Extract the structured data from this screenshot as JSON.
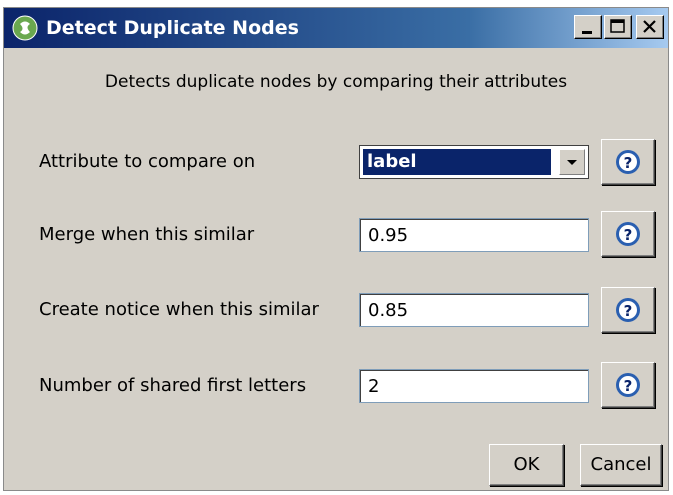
{
  "window": {
    "title": "Detect Duplicate Nodes"
  },
  "description": "Detects duplicate nodes by comparing their attributes",
  "fields": [
    {
      "label": "Attribute to compare on",
      "type": "select",
      "value": "label"
    },
    {
      "label": "Merge when this similar",
      "type": "text",
      "value": "0.95"
    },
    {
      "label": "Create notice when this similar",
      "type": "text",
      "value": "0.85"
    },
    {
      "label": "Number of shared first letters",
      "type": "text",
      "value": "2"
    }
  ],
  "buttons": {
    "ok": "OK",
    "cancel": "Cancel"
  },
  "icons": {
    "app": "cytoscape-app-icon",
    "help": "help-question-icon",
    "dropdown": "chevron-down-icon"
  },
  "colors": {
    "titlebar_start": "#0b246a",
    "titlebar_end": "#a6caf0",
    "dialog_bg": "#d4d0c8",
    "selection_bg": "#0a246a"
  }
}
